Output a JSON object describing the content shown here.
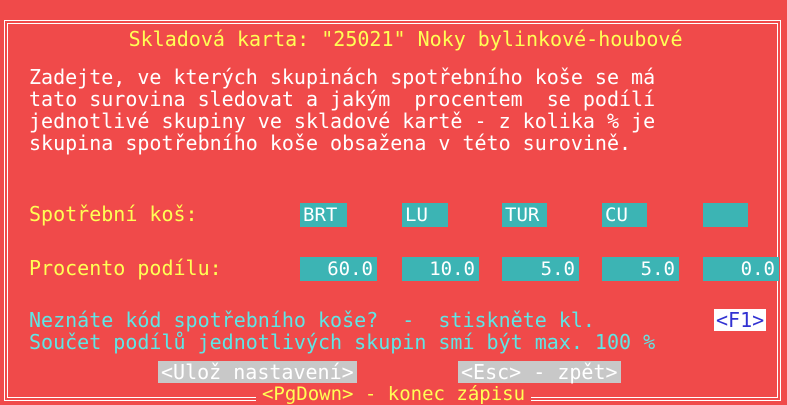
{
  "window": {
    "title_left": "Skladová karta: \"25021\"",
    "title_right": "Noky bylinkové-houbové"
  },
  "instructions": {
    "line1": "Zadejte, ve kterých skupinách spotřebního koše se má",
    "line2": "tato surovina sledovat a jakým  procentem  se podílí",
    "line3": "jednotlivé skupiny ve skladové kartě - z kolika % je",
    "line4": "skupina spotřebního koše obsažena v této surovině."
  },
  "basket": {
    "label": "Spotřební koš:",
    "codes": [
      "BRT",
      "LU",
      "TUR",
      "CU",
      ""
    ]
  },
  "share": {
    "label": "Procento podílu:",
    "values": [
      "60.0",
      "10.0",
      "5.0",
      "5.0",
      "0.0"
    ]
  },
  "help": {
    "line1": "Neznáte kód spotřebního koše?  -  stiskněte kl.",
    "key": "<F1>",
    "line2": "Součet podílů jednotlivých skupin smí být max. 100 %"
  },
  "actions": {
    "save": "<Ulož nastavení>",
    "back": "<Esc> - zpět>"
  },
  "footer": {
    "pgdown": "<PgDown> - konec zápisu"
  }
}
